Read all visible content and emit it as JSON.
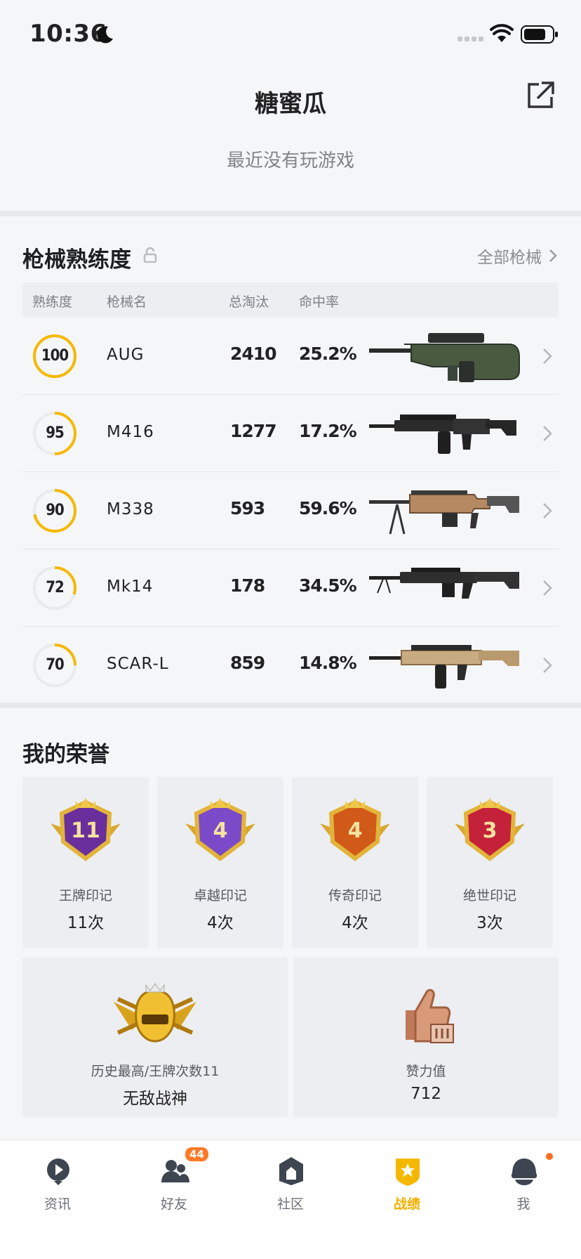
{
  "status_bar": {
    "time": "10:36"
  },
  "header": {
    "title": "糖蜜瓜",
    "subtitle": "最近没有玩游戏"
  },
  "weapons_section": {
    "title": "枪械熟练度",
    "all_link": "全部枪械",
    "columns": [
      "熟练度",
      "枪械名",
      "总淘汰",
      "命中率"
    ],
    "rows": [
      {
        "proficiency": "100",
        "level": 1.0,
        "name": "AUG",
        "kills": "2410",
        "accuracy": "25.2%"
      },
      {
        "proficiency": "95",
        "level": 0.5,
        "name": "M416",
        "kills": "1277",
        "accuracy": "17.2%"
      },
      {
        "proficiency": "90",
        "level": 0.72,
        "name": "M338",
        "kills": "593",
        "accuracy": "59.6%"
      },
      {
        "proficiency": "72",
        "level": 0.3,
        "name": "Mk14",
        "kills": "178",
        "accuracy": "34.5%"
      },
      {
        "proficiency": "70",
        "level": 0.25,
        "name": "SCAR-L",
        "kills": "859",
        "accuracy": "14.8%"
      }
    ]
  },
  "honors_section": {
    "title": "我的荣誉",
    "badges": [
      {
        "label": "王牌印记",
        "count": "11次",
        "badge_num": "11",
        "color": "#6a2f9c"
      },
      {
        "label": "卓越印记",
        "count": "4次",
        "badge_num": "4",
        "color": "#7b4ac8"
      },
      {
        "label": "传奇印记",
        "count": "4次",
        "badge_num": "4",
        "color": "#d25a18"
      },
      {
        "label": "绝世印记",
        "count": "3次",
        "badge_num": "3",
        "color": "#c4213a"
      }
    ],
    "highest": {
      "label": "历史最高/王牌次数11",
      "value": "无敌战神"
    },
    "likes": {
      "label": "赞力值",
      "value": "712"
    }
  },
  "tabbar": {
    "tabs": [
      {
        "label": "资讯",
        "icon": "news-icon"
      },
      {
        "label": "好友",
        "icon": "friends-icon",
        "badge": "44"
      },
      {
        "label": "社区",
        "icon": "community-icon"
      },
      {
        "label": "战绩",
        "icon": "record-icon",
        "active": true
      },
      {
        "label": "我",
        "icon": "me-icon"
      }
    ]
  },
  "colors": {
    "accent": "#f5b800",
    "text": "#222222",
    "muted": "#808489"
  }
}
